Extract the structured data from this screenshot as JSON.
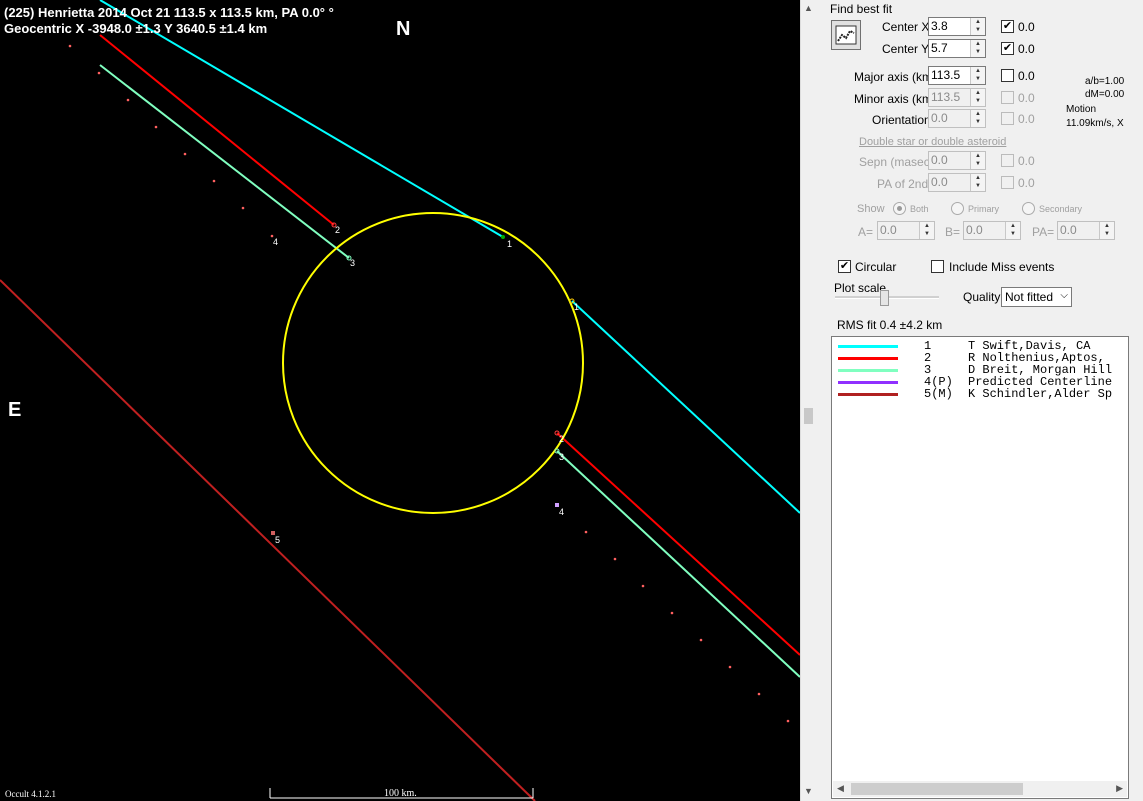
{
  "plot": {
    "header_line1": "(225) Henrietta  2014 Oct 21   113.5 x 113.5 km, PA 0.0° °",
    "header_line2": "Geocentric  X  -3948.0 ±1.3  Y 3640.5 ±1.4 km",
    "north": "N",
    "east": "E",
    "version": "Occult 4.1.2.1",
    "scale_label": "100 km.",
    "chord_labels": [
      "1",
      "2",
      "3",
      "4",
      "5",
      "1",
      "2",
      "3",
      "4"
    ],
    "colors": {
      "cyan": "#00ffff",
      "red": "#ff0000",
      "aqua": "#80ffc0",
      "darkred": "#c02020",
      "yellow": "#ffff00",
      "pink": "#ff6060"
    }
  },
  "panel": {
    "find_best_fit": "Find best fit",
    "center_x_label": "Center X",
    "center_x_value": "3.8",
    "center_x_check": "0.0",
    "center_y_label": "Center Y",
    "center_y_value": "5.7",
    "center_y_check": "0.0",
    "major_label": "Major axis (km)",
    "major_value": "113.5",
    "major_check": "0.0",
    "minor_label": "Minor axis (km)",
    "minor_value": "113.5",
    "minor_check": "0.0",
    "orientation_label": "Orientation",
    "orientation_value": "0.0",
    "orientation_check": "0.0",
    "ab_ratio": "a/b=1.00",
    "dm": "dM=0.00",
    "motion_label": "Motion",
    "motion_value": "11.09km/s, X",
    "double_star_link": "Double star  or  double asteroid",
    "sepn_label": "Sepn (masec)",
    "sepn_value": "0.0",
    "sepn_check": "0.0",
    "pa2_label": "PA of 2nd",
    "pa2_value": "0.0",
    "pa2_check": "0.0",
    "show_label": "Show",
    "show_both": "Both",
    "show_primary": "Primary",
    "show_secondary": "Secondary",
    "a_label": "A=",
    "a_value": "0.0",
    "b_label": "B=",
    "b_value": "0.0",
    "pa_label": "PA=",
    "pa_value": "0.0",
    "circular_label": "Circular",
    "include_miss_label": "Include Miss events",
    "plot_scale_label": "Plot scale",
    "quality_label": "Quality",
    "quality_value": "Not fitted",
    "rms_fit": "RMS fit  0.4 ±4.2 km",
    "legend": [
      {
        "num": "1",
        "text": "T Swift,Davis, CA",
        "color": "#00ffff"
      },
      {
        "num": "2",
        "text": "R Nolthenius,Aptos,",
        "color": "#ff0000"
      },
      {
        "num": "3",
        "text": "D Breit, Morgan Hill",
        "color": "#80ffc0"
      },
      {
        "num": "4(P)",
        "text": "Predicted Centerline",
        "color": "#9030ff"
      },
      {
        "num": "5(M)",
        "text": "K Schindler,Alder Sp",
        "color": "#b02020"
      }
    ]
  }
}
